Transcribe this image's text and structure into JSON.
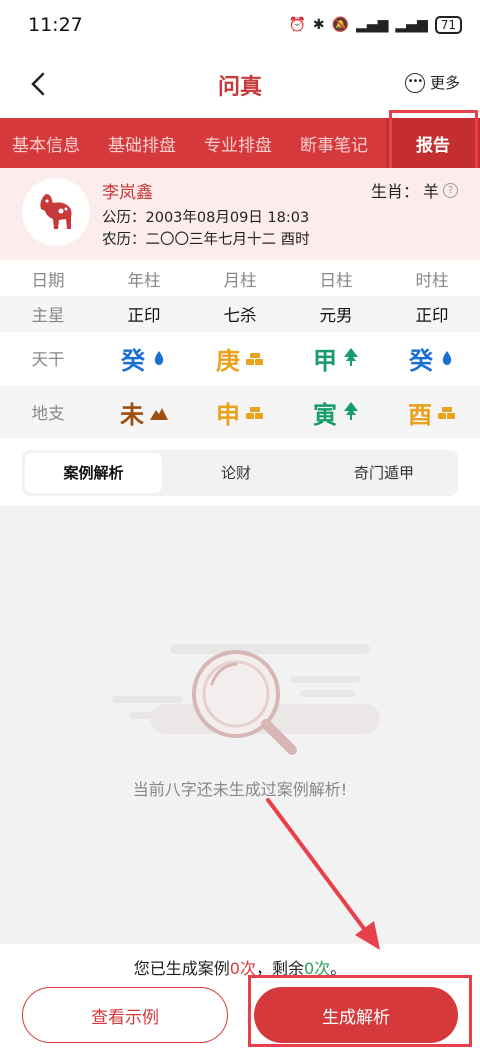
{
  "status": {
    "time": "11:27",
    "battery": "71"
  },
  "nav": {
    "title": "问真",
    "more_label": "更多"
  },
  "tabs": [
    {
      "label": "基本信息"
    },
    {
      "label": "基础排盘"
    },
    {
      "label": "专业排盘"
    },
    {
      "label": "断事笔记"
    },
    {
      "label": "报告"
    }
  ],
  "profile": {
    "name": "李岚鑫",
    "zodiac_label": "生肖：",
    "zodiac_value": "羊",
    "solar": "公历：2003年08月09日 18:03",
    "lunar": "农历：二〇〇三年七月十二  酉时"
  },
  "grid": {
    "headers": [
      "日期",
      "年柱",
      "月柱",
      "日柱",
      "时柱"
    ],
    "main_star": {
      "label": "主星",
      "values": [
        "正印",
        "七杀",
        "元男",
        "正印"
      ]
    },
    "tiangan": {
      "label": "天干",
      "values": [
        {
          "char": "癸",
          "color": "#1a6fd1",
          "element": "water-drop-icon"
        },
        {
          "char": "庚",
          "color": "#e8a21c",
          "element": "gold-icon"
        },
        {
          "char": "甲",
          "color": "#169c6b",
          "element": "tree-icon"
        },
        {
          "char": "癸",
          "color": "#1a6fd1",
          "element": "water-drop-icon"
        }
      ]
    },
    "dizhi": {
      "label": "地支",
      "values": [
        {
          "char": "未",
          "color": "#9b4f12",
          "element": "mountain-icon"
        },
        {
          "char": "申",
          "color": "#e8a21c",
          "element": "gold-icon"
        },
        {
          "char": "寅",
          "color": "#169c6b",
          "element": "tree-icon"
        },
        {
          "char": "酉",
          "color": "#e8a21c",
          "element": "gold-icon"
        }
      ]
    }
  },
  "subtabs": [
    {
      "label": "案例解析"
    },
    {
      "label": "论财"
    },
    {
      "label": "奇门遁甲"
    }
  ],
  "content": {
    "empty_text": "当前八字还未生成过案例解析!"
  },
  "footer": {
    "count_prefix": "您已生成案例",
    "count_used": "0次",
    "count_mid": "，剩余",
    "count_left": "0次",
    "count_suffix": "。",
    "example_button": "查看示例",
    "generate_button": "生成解析"
  },
  "colors": {
    "accent": "#d6393b"
  }
}
